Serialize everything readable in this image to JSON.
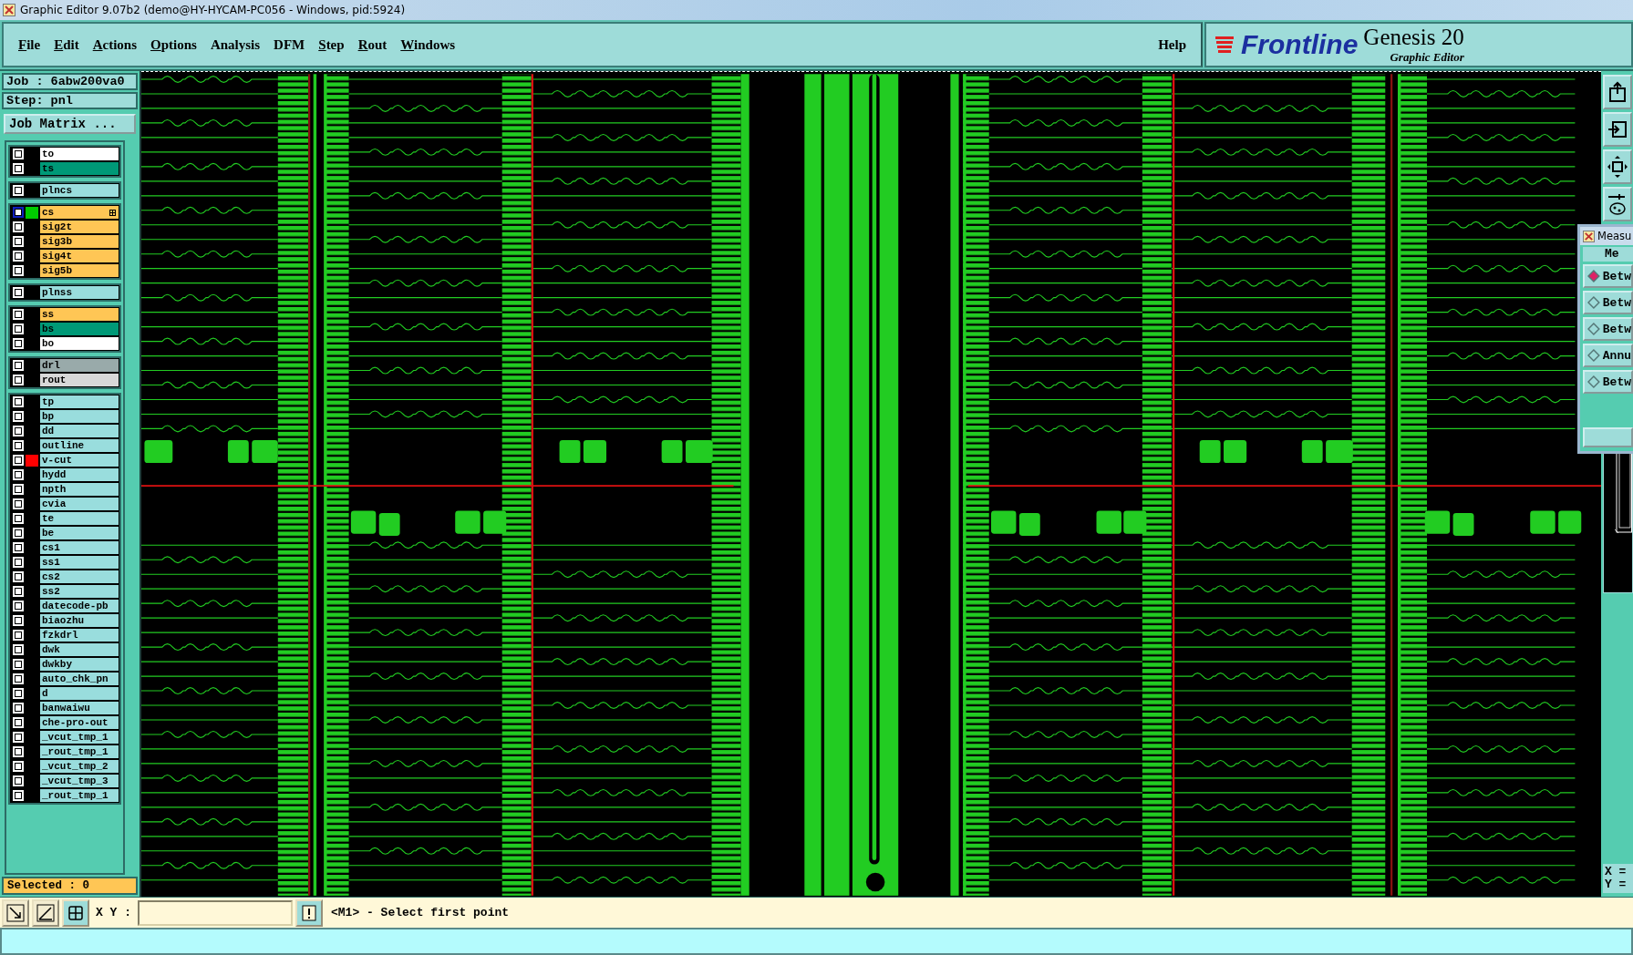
{
  "window": {
    "title": "Graphic Editor 9.07b2 (demo@HY-HYCAM-PC056 - Windows, pid:5924)"
  },
  "menu": [
    {
      "label": "File",
      "underlined": true
    },
    {
      "label": "Edit",
      "underlined": true
    },
    {
      "label": "Actions",
      "underlined": true
    },
    {
      "label": "Options",
      "underlined": true
    },
    {
      "label": "Analysis",
      "underlined": false
    },
    {
      "label": "DFM",
      "underlined": false
    },
    {
      "label": "Step",
      "underlined": true
    },
    {
      "label": "Rout",
      "underlined": true
    },
    {
      "label": "Windows",
      "underlined": true
    }
  ],
  "help": "Help",
  "logo": {
    "brand": "Frontline",
    "product": "Genesis 20",
    "subtitle": "Graphic Editor"
  },
  "job": "Job : 6abw200va0",
  "step": "Step: pnl",
  "job_matrix_button": "Job Matrix ...",
  "layer_groups": [
    {
      "layers": [
        {
          "name": "to",
          "color": "#ffffff",
          "checked": false,
          "selected": false
        },
        {
          "name": "ts",
          "color": "#009977",
          "checked": false,
          "selected": false
        }
      ]
    },
    {
      "layers": [
        {
          "name": "plncs",
          "color": "#99dddd",
          "checked": false,
          "selected": false
        }
      ]
    },
    {
      "layers": [
        {
          "name": "cs",
          "color": "#ffc655",
          "swatch": {
            "color": "#00cc00"
          },
          "checked": false,
          "selected": true
        },
        {
          "name": "sig2t",
          "color": "#ffc655",
          "checked": false,
          "selected": false
        },
        {
          "name": "sig3b",
          "color": "#ffc655",
          "checked": false,
          "selected": false
        },
        {
          "name": "sig4t",
          "color": "#ffc655",
          "checked": false,
          "selected": false
        },
        {
          "name": "sig5b",
          "color": "#ffc655",
          "checked": false,
          "selected": false
        }
      ]
    },
    {
      "layers": [
        {
          "name": "plnss",
          "color": "#99dddd",
          "checked": false,
          "selected": false
        }
      ]
    },
    {
      "layers": [
        {
          "name": "ss",
          "color": "#ffc655",
          "checked": false,
          "selected": false
        },
        {
          "name": "bs",
          "color": "#009977",
          "checked": false,
          "selected": false
        },
        {
          "name": "bo",
          "color": "#ffffff",
          "checked": false,
          "selected": false
        }
      ]
    },
    {
      "layers": [
        {
          "name": "drl",
          "color": "#99aaaa",
          "checked": false,
          "selected": false
        },
        {
          "name": "rout",
          "color": "#d8d8d8",
          "checked": false,
          "selected": false
        }
      ]
    },
    {
      "layers": [
        {
          "name": "tp",
          "color": "#99dddd",
          "checked": false,
          "selected": false
        },
        {
          "name": "bp",
          "color": "#99dddd",
          "checked": false,
          "selected": false
        },
        {
          "name": "dd",
          "color": "#99dddd",
          "checked": false,
          "selected": false
        },
        {
          "name": "outline",
          "color": "#99dddd",
          "checked": false,
          "selected": false
        },
        {
          "name": "v-cut",
          "color": "#99dddd",
          "swatch": {
            "color": "#ff0000"
          },
          "checked": false,
          "selected": false
        },
        {
          "name": "hydd",
          "color": "#99dddd",
          "checked": false,
          "selected": false
        },
        {
          "name": "npth",
          "color": "#99dddd",
          "checked": false,
          "selected": false
        },
        {
          "name": "cvia",
          "color": "#99dddd",
          "checked": false,
          "selected": false
        },
        {
          "name": "te",
          "color": "#99dddd",
          "checked": false,
          "selected": false
        },
        {
          "name": "be",
          "color": "#99dddd",
          "checked": false,
          "selected": false
        },
        {
          "name": "cs1",
          "color": "#99dddd",
          "checked": false,
          "selected": false
        },
        {
          "name": "ss1",
          "color": "#99dddd",
          "checked": false,
          "selected": false
        },
        {
          "name": "cs2",
          "color": "#99dddd",
          "checked": false,
          "selected": false
        },
        {
          "name": "ss2",
          "color": "#99dddd",
          "checked": false,
          "selected": false
        },
        {
          "name": "datecode-pb",
          "color": "#99dddd",
          "checked": false,
          "selected": false
        },
        {
          "name": "biaozhu",
          "color": "#99dddd",
          "checked": false,
          "selected": false
        },
        {
          "name": "fzkdrl",
          "color": "#99dddd",
          "checked": false,
          "selected": false
        },
        {
          "name": "dwk",
          "color": "#99dddd",
          "checked": false,
          "selected": false
        },
        {
          "name": "dwkby",
          "color": "#99dddd",
          "checked": false,
          "selected": false
        },
        {
          "name": "auto_chk_pn",
          "color": "#99dddd",
          "checked": false,
          "selected": false
        },
        {
          "name": "d",
          "color": "#99dddd",
          "checked": false,
          "selected": false
        },
        {
          "name": "banwaiwu",
          "color": "#99dddd",
          "checked": false,
          "selected": false
        },
        {
          "name": "che-pro-out",
          "color": "#99dddd",
          "checked": false,
          "selected": false
        },
        {
          "name": "_vcut_tmp_1",
          "color": "#99dddd",
          "checked": false,
          "selected": false
        },
        {
          "name": "_rout_tmp_1",
          "color": "#99dddd",
          "checked": false,
          "selected": false
        },
        {
          "name": "_vcut_tmp_2",
          "color": "#99dddd",
          "checked": false,
          "selected": false
        },
        {
          "name": "_vcut_tmp_3",
          "color": "#99dddd",
          "checked": false,
          "selected": false
        },
        {
          "name": "_rout_tmp_1",
          "color": "#99dddd",
          "checked": false,
          "selected": false
        }
      ]
    }
  ],
  "selected_count": "Selected : 0",
  "measure_dialog": {
    "title": "Measu",
    "header": "Me",
    "options": [
      {
        "label": "Betw",
        "selected": true
      },
      {
        "label": "Betw",
        "selected": false
      },
      {
        "label": "Betw",
        "selected": false
      },
      {
        "label": "Annu",
        "selected": false
      },
      {
        "label": "Betw",
        "selected": false
      }
    ]
  },
  "coords": {
    "x": "X =",
    "y": "Y ="
  },
  "bottom": {
    "xy_label": "X Y :",
    "prompt": "<M1> - Select first point"
  }
}
